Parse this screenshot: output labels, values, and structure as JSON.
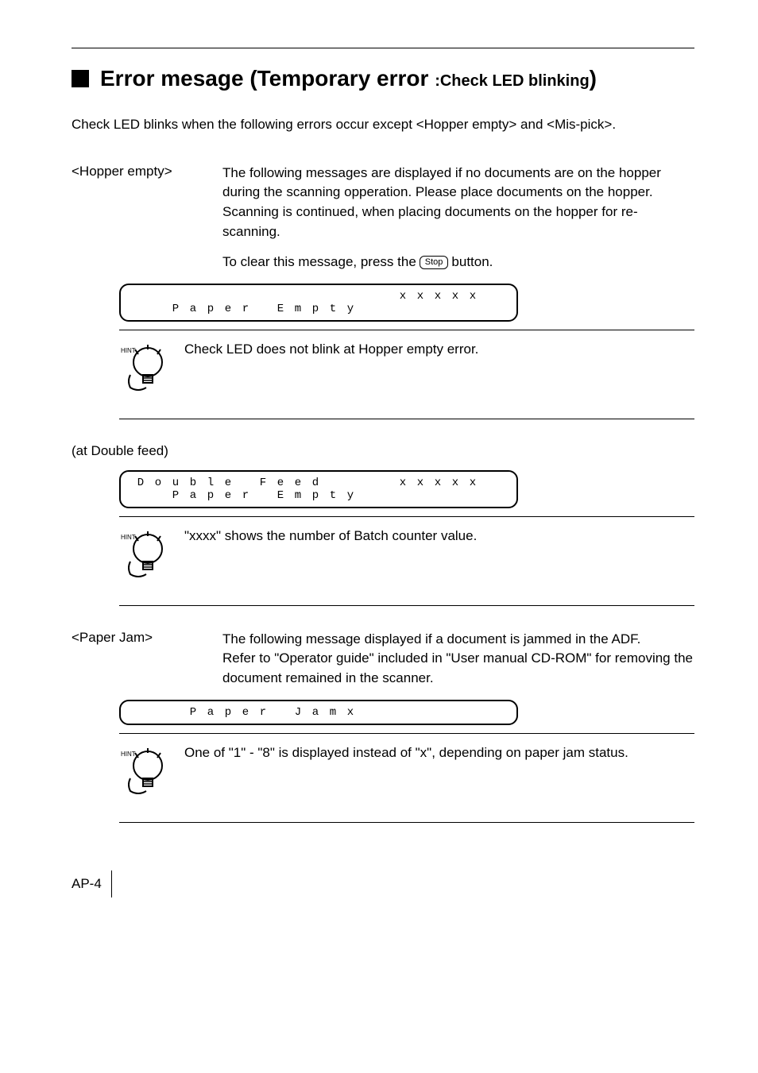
{
  "title_main": "Error mesage (Temporary error ",
  "title_sub": ":Check LED blinking",
  "title_end": ")",
  "intro": "Check LED blinks when the following errors occur except <Hopper empty> and <Mis-pick>.",
  "hopper": {
    "label": "<Hopper empty>",
    "para1": "The following messages are displayed if no documents are on the hopper during the scanning opperation. Please place documents on the hopper. Scanning is continued, when placing documents on the hopper for re-scanning.",
    "para2a": "To clear this message, press the ",
    "stop": "Stop",
    "para2b": " button.",
    "lcd_row1": [
      "",
      "",
      "",
      "",
      "",
      "",
      "",
      "",
      "",
      "",
      "",
      "",
      "",
      "",
      "",
      "x",
      "x",
      "x",
      "x",
      "x"
    ],
    "lcd_row2": [
      "",
      "",
      "P",
      "a",
      "p",
      "e",
      "r",
      "",
      "E",
      "m",
      "p",
      "t",
      "y",
      "",
      "",
      "",
      "",
      "",
      "",
      ""
    ],
    "hint": "Check LED does not blink at Hopper empty error."
  },
  "double": {
    "label": "(at Double feed)",
    "lcd_row1": [
      "D",
      "o",
      "u",
      "b",
      "l",
      "e",
      "",
      "F",
      "e",
      "e",
      "d",
      "",
      "",
      "",
      "",
      "x",
      "x",
      "x",
      "x",
      "x"
    ],
    "lcd_row2": [
      "",
      "",
      "P",
      "a",
      "p",
      "e",
      "r",
      "",
      "E",
      "m",
      "p",
      "t",
      "y",
      "",
      "",
      "",
      "",
      "",
      "",
      ""
    ],
    "hint": "\"xxxx\" shows the number of Batch counter value."
  },
  "jam": {
    "label": "<Paper Jam>",
    "para1": "The following message displayed if a document is jammed in the ADF.",
    "para2": "Refer to \"Operator guide\" included in \"User manual CD-ROM\" for removing the document remained in the scanner.",
    "lcd_row1": [
      "",
      "",
      "",
      "",
      "",
      "",
      "",
      "",
      "",
      "",
      "",
      "",
      "",
      "",
      "",
      "",
      "",
      "",
      "",
      ""
    ],
    "lcd_row2": [
      "",
      "",
      "",
      "P",
      "a",
      "p",
      "e",
      "r",
      "",
      "J",
      "a",
      "m",
      "x",
      "",
      "",
      "",
      "",
      "",
      "",
      ""
    ],
    "hint": "One of \"1\" - \"8\" is displayed instead of \"x\", depending on paper jam status."
  },
  "footer": "AP-4",
  "hint_label": "HINT"
}
